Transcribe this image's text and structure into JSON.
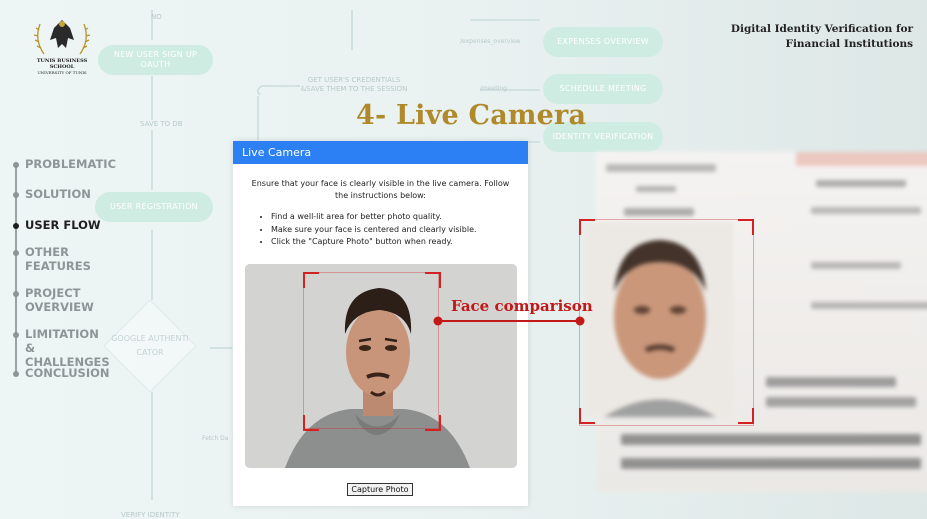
{
  "header": {
    "logo_text": "TUNIS BUSINESS SCHOOL",
    "logo_subtext": "UNIVERSITY OF TUNIS",
    "project_title_line1": "Digital Identity Verification for",
    "project_title_line2": "Financial Institutions",
    "slide_title": "4- Live Camera"
  },
  "nav": {
    "items": [
      {
        "label": "PROBLEMATIC",
        "active": false
      },
      {
        "label": "SOLUTION",
        "active": false
      },
      {
        "label": "USER FLOW",
        "active": true
      },
      {
        "label": "OTHER FEATURES",
        "active": false
      },
      {
        "label": "PROJECT OVERVIEW",
        "active": false
      },
      {
        "label": "LIMITATION & CHALLENGES",
        "active": false
      },
      {
        "label": "CONCLUSION",
        "active": false
      }
    ]
  },
  "background_flow": {
    "pill_new_user": "NEW USER SIGN UP OAUTH",
    "pill_user_registration": "USER REGISTRATION",
    "pill_expenses": "EXPENSES OVERVIEW",
    "pill_schedule": "SCHEDULE MEETING",
    "pill_identity": "IDENTITY VERIFICATION",
    "note_credentials": "GET USER'S CREDENTIALS &SAVE THEM TO THE SESSION",
    "note_save": "SAVE TO DB",
    "note_no": "NO",
    "diamond": "GOOGLE AUTHENTI CATOR",
    "small_expenses": "/expenses_overview",
    "small_meeting": "/meeting",
    "small_fetch": "Fetch Da",
    "small_verify": "VERIFY IDENTITY"
  },
  "panel": {
    "header": "Live Camera",
    "intro": "Ensure that your face is clearly visible in the live camera. Follow the instructions below:",
    "instructions": [
      "Find a well-lit area for better photo quality.",
      "Make sure your face is centered and clearly visible.",
      "Click the \"Capture Photo\" button when ready."
    ],
    "capture_button": "Capture Photo"
  },
  "annotation": {
    "label": "Face comparison",
    "color": "#c21818"
  },
  "colors": {
    "accent_blue": "#2d7ff4",
    "title_gold": "#b08a2a",
    "flow_green": "#cfece2"
  }
}
